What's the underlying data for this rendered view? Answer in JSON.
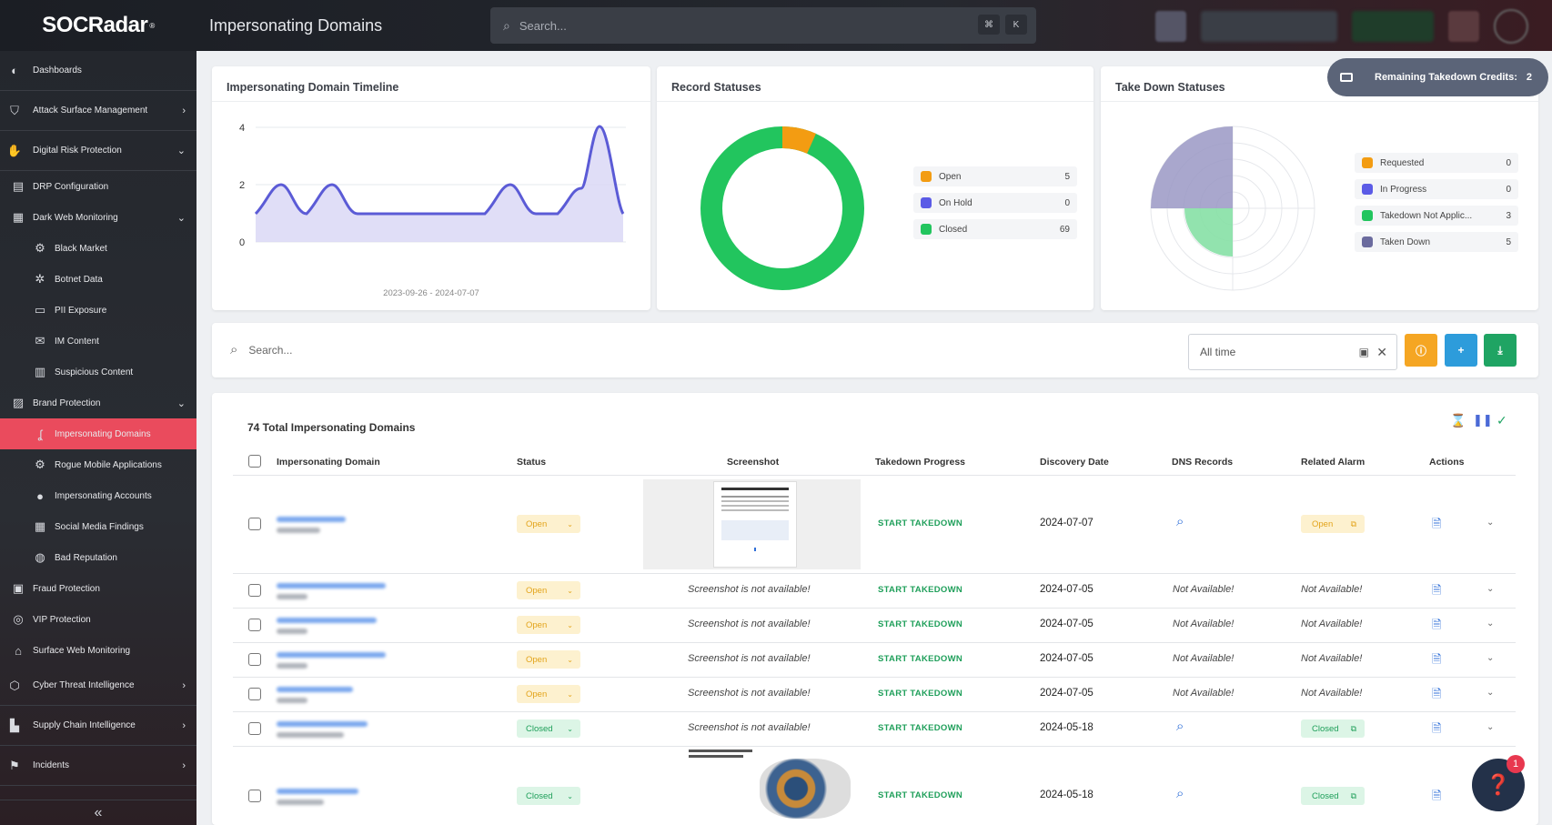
{
  "app": {
    "logo": "SOCRadar",
    "page_title": "Impersonating Domains",
    "search_placeholder": "Search...",
    "kbd_cmd": "⌘",
    "kbd_k": "K"
  },
  "sidebar": {
    "items": [
      {
        "label": "Dashboards",
        "icon": "dashboard-icon",
        "level": 0
      },
      {
        "label": "Attack Surface Management",
        "icon": "shield-icon",
        "level": 0,
        "chevron": "›"
      },
      {
        "label": "Digital Risk Protection",
        "icon": "hand-icon",
        "level": 0,
        "chevron": "⌄"
      },
      {
        "label": "DRP Configuration",
        "icon": "config-icon",
        "level": 1
      },
      {
        "label": "Dark Web Monitoring",
        "icon": "dark-web-icon",
        "level": 1,
        "chevron": "⌄"
      },
      {
        "label": "Black Market",
        "icon": "market-icon",
        "level": 2
      },
      {
        "label": "Botnet Data",
        "icon": "bug-icon",
        "level": 2
      },
      {
        "label": "PII Exposure",
        "icon": "id-card-icon",
        "level": 2
      },
      {
        "label": "IM Content",
        "icon": "message-icon",
        "level": 2
      },
      {
        "label": "Suspicious Content",
        "icon": "content-icon",
        "level": 2
      },
      {
        "label": "Brand Protection",
        "icon": "brand-icon",
        "level": 1,
        "chevron": "⌄"
      },
      {
        "label": "Impersonating Domains",
        "icon": "hook-icon",
        "level": 2,
        "active": true
      },
      {
        "label": "Rogue Mobile Applications",
        "icon": "mobile-icon",
        "level": 2
      },
      {
        "label": "Impersonating Accounts",
        "icon": "user-icon",
        "level": 2
      },
      {
        "label": "Social Media Findings",
        "icon": "grid-icon",
        "level": 2
      },
      {
        "label": "Bad Reputation",
        "icon": "globe-icon",
        "level": 2
      },
      {
        "label": "Fraud Protection",
        "icon": "fraud-icon",
        "level": 1
      },
      {
        "label": "VIP Protection",
        "icon": "vip-icon",
        "level": 1
      },
      {
        "label": "Surface Web Monitoring",
        "icon": "web-icon",
        "level": 1
      },
      {
        "label": "Cyber Threat Intelligence",
        "icon": "radar-icon",
        "level": 0,
        "chevron": "›"
      },
      {
        "label": "Supply Chain Intelligence",
        "icon": "factory-icon",
        "level": 0,
        "chevron": "›"
      },
      {
        "label": "Incidents",
        "icon": "incident-icon",
        "level": 0,
        "chevron": "›"
      }
    ],
    "collapse": "«"
  },
  "timeline": {
    "title": "Impersonating Domain Timeline",
    "range": "2023-09-26 - 2024-07-07",
    "yticks": [
      "4",
      "2",
      "0"
    ]
  },
  "record_statuses": {
    "title": "Record Statuses",
    "legend": [
      {
        "label": "Open",
        "value": "5",
        "color": "#f39c12"
      },
      {
        "label": "On Hold",
        "value": "0",
        "color": "#5b5be6"
      },
      {
        "label": "Closed",
        "value": "69",
        "color": "#22c55e"
      }
    ]
  },
  "takedown_statuses": {
    "title": "Take Down Statuses",
    "legend": [
      {
        "label": "Requested",
        "value": "0",
        "color": "#f39c12"
      },
      {
        "label": "In Progress",
        "value": "0",
        "color": "#5b5be6"
      },
      {
        "label": "Takedown Not Applic...",
        "value": "3",
        "color": "#22c55e"
      },
      {
        "label": "Taken Down",
        "value": "5",
        "color": "#6b6b9e"
      }
    ]
  },
  "credits": {
    "label": "Remaining Takedown Credits:",
    "value": "2"
  },
  "filter": {
    "search_placeholder": "Search...",
    "date_value": "All time"
  },
  "table": {
    "total": "74 Total Impersonating Domains",
    "headers": [
      "Impersonating Domain",
      "Status",
      "Screenshot",
      "Takedown Progress",
      "Discovery Date",
      "DNS Records",
      "Related Alarm",
      "Actions"
    ],
    "rows": [
      {
        "status": "Open",
        "screenshot": "image",
        "takedown": "START TAKEDOWN",
        "date": "2024-07-07",
        "dns": "icon",
        "alarm": "Open"
      },
      {
        "status": "Open",
        "screenshot": "Screenshot is not available!",
        "takedown": "START TAKEDOWN",
        "date": "2024-07-05",
        "dns": "Not Available!",
        "alarm": "Not Available!"
      },
      {
        "status": "Open",
        "screenshot": "Screenshot is not available!",
        "takedown": "START TAKEDOWN",
        "date": "2024-07-05",
        "dns": "Not Available!",
        "alarm": "Not Available!"
      },
      {
        "status": "Open",
        "screenshot": "Screenshot is not available!",
        "takedown": "START TAKEDOWN",
        "date": "2024-07-05",
        "dns": "Not Available!",
        "alarm": "Not Available!"
      },
      {
        "status": "Open",
        "screenshot": "Screenshot is not available!",
        "takedown": "START TAKEDOWN",
        "date": "2024-07-05",
        "dns": "Not Available!",
        "alarm": "Not Available!"
      },
      {
        "status": "Closed",
        "screenshot": "Screenshot is not available!",
        "takedown": "START TAKEDOWN",
        "date": "2024-05-18",
        "dns": "icon",
        "alarm": "Closed"
      },
      {
        "status": "Closed",
        "screenshot": "image",
        "takedown": "START TAKEDOWN",
        "date": "2024-05-18",
        "dns": "icon",
        "alarm": "Closed"
      }
    ]
  },
  "chat": {
    "badge": "1"
  }
}
